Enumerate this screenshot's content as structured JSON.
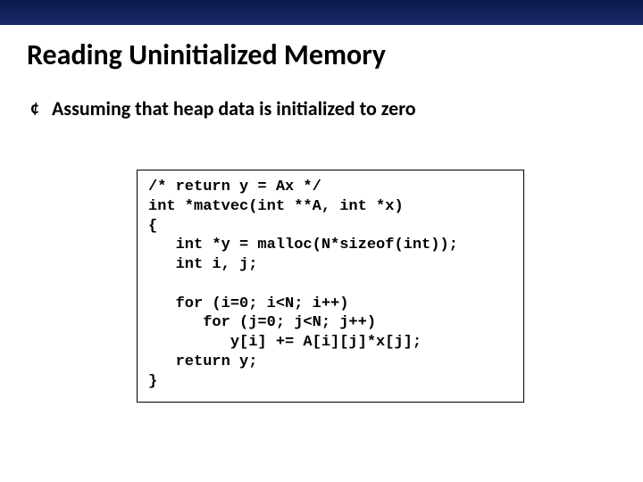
{
  "title": "Reading Uninitialized Memory",
  "bullet": {
    "marker": "¢",
    "text": "Assuming that heap data is initialized to zero"
  },
  "code": "/* return y = Ax */\nint *matvec(int **A, int *x)\n{\n   int *y = malloc(N*sizeof(int));\n   int i, j;\n\n   for (i=0; i<N; i++)\n      for (j=0; j<N; j++)\n         y[i] += A[i][j]*x[j];\n   return y;\n}"
}
